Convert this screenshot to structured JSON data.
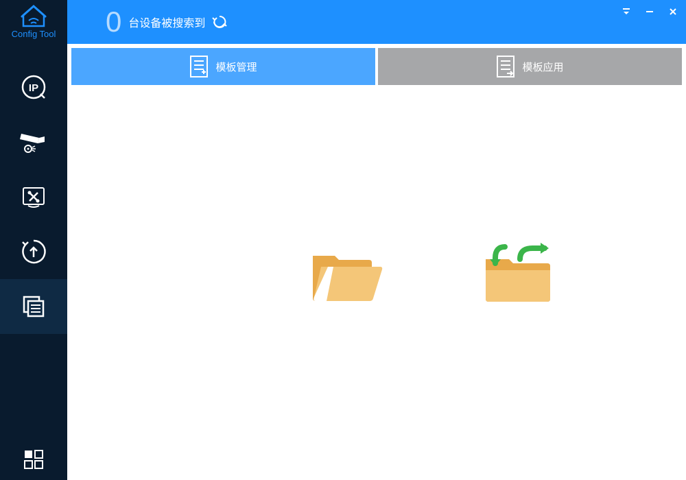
{
  "app_name": "Config Tool",
  "header": {
    "device_count": "0",
    "status_text": "台设备被搜索到"
  },
  "sidebar": {
    "items": [
      {
        "name": "ip"
      },
      {
        "name": "camera"
      },
      {
        "name": "tools"
      },
      {
        "name": "upgrade"
      },
      {
        "name": "templates"
      }
    ]
  },
  "tabs": {
    "manage": {
      "label": "模板管理"
    },
    "apply": {
      "label": "模板应用"
    }
  },
  "colors": {
    "primary": "#1e90ff",
    "sidebar_bg": "#091b2e",
    "tab_inactive": "#a6a7a9",
    "folder": "#f0b95c",
    "folder_accent": "#3bb54a"
  }
}
